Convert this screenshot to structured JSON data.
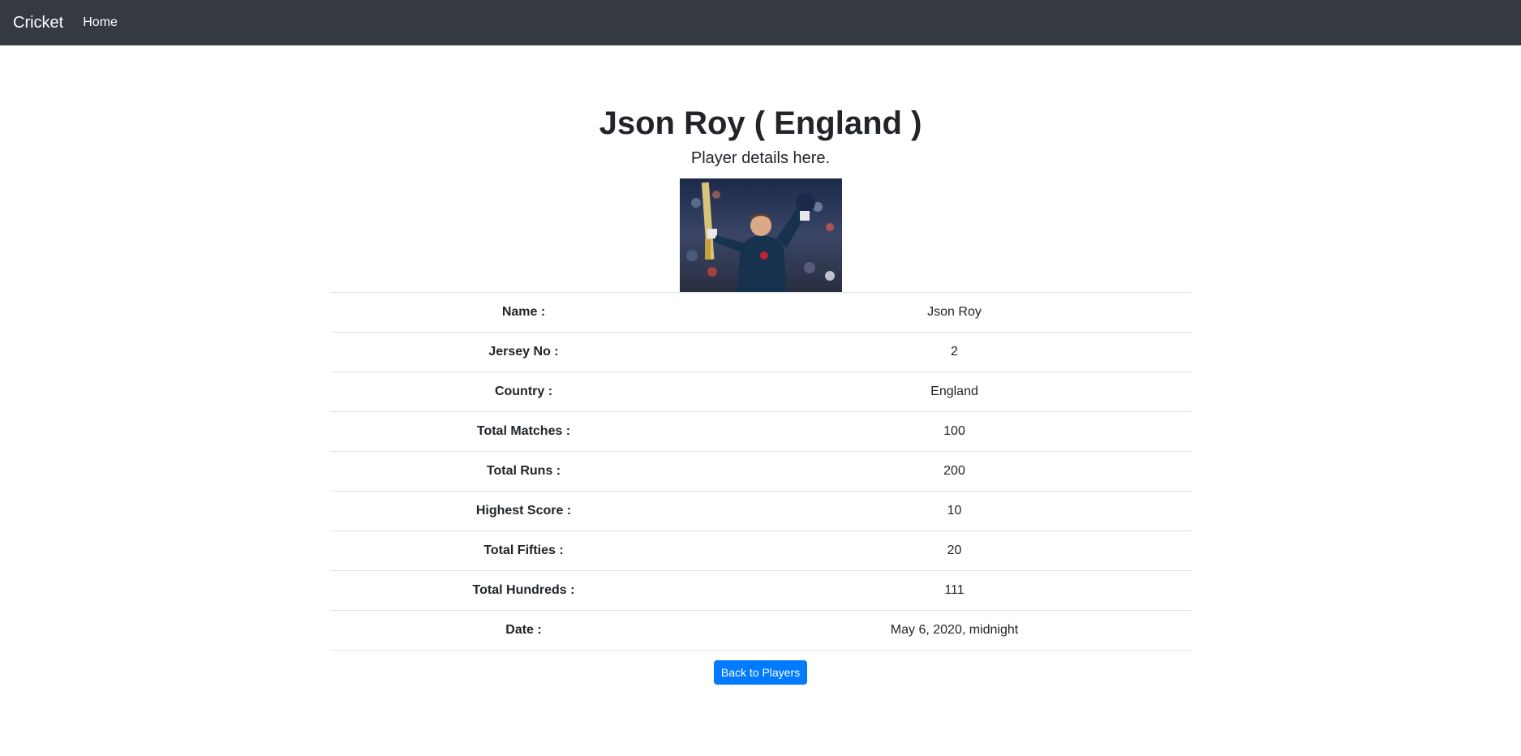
{
  "navbar": {
    "brand": "Cricket",
    "links": [
      "Home"
    ]
  },
  "header": {
    "title": "Json Roy ( England )",
    "subtitle": "Player details here."
  },
  "photo": {
    "alt": "player-photo"
  },
  "details": [
    {
      "label": "Name :",
      "value": "Json Roy"
    },
    {
      "label": "Jersey No :",
      "value": "2"
    },
    {
      "label": "Country :",
      "value": "England"
    },
    {
      "label": "Total Matches :",
      "value": "100"
    },
    {
      "label": "Total Runs :",
      "value": "200"
    },
    {
      "label": "Highest Score :",
      "value": "10"
    },
    {
      "label": "Total Fifties :",
      "value": "20"
    },
    {
      "label": "Total Hundreds :",
      "value": "111"
    },
    {
      "label": "Date :",
      "value": "May 6, 2020, midnight"
    }
  ],
  "actions": {
    "back_label": "Back to Players"
  },
  "colors": {
    "navbar_bg": "#343a40",
    "primary": "#007bff",
    "text": "#212529",
    "divider": "#dee2e6"
  }
}
